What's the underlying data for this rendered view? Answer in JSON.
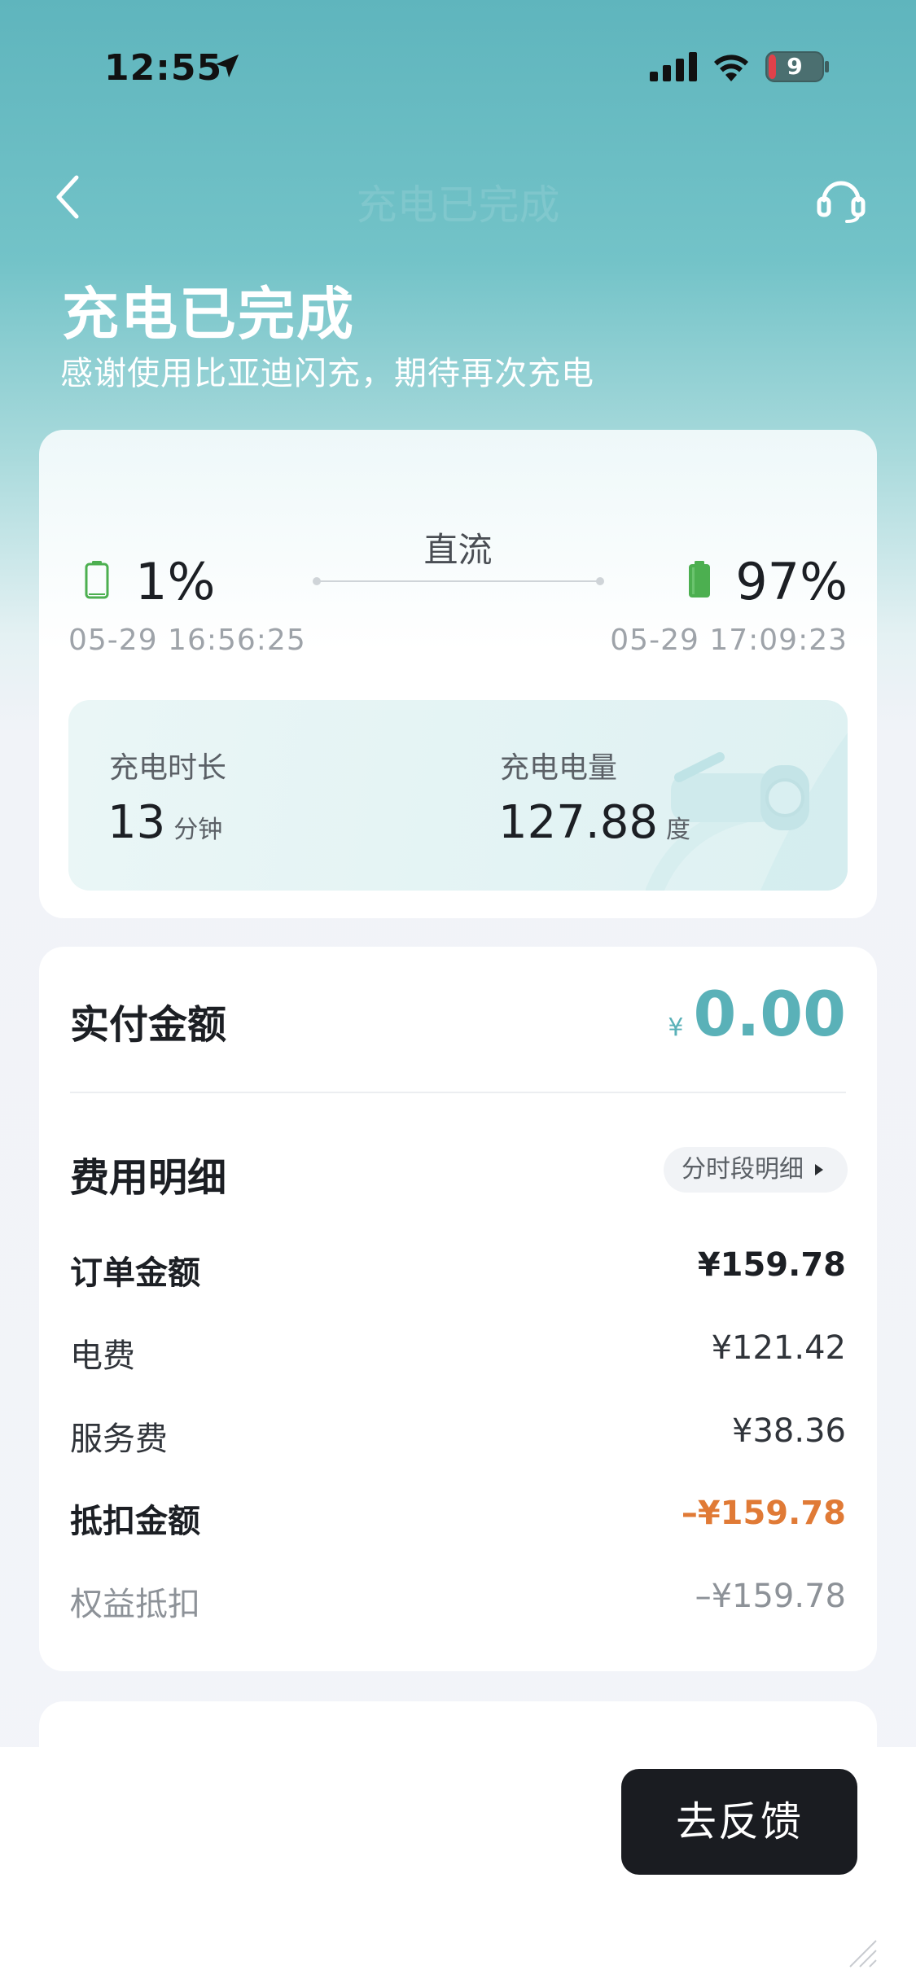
{
  "status_bar": {
    "time": "12:55",
    "battery_level": "9"
  },
  "nav": {
    "title": "充电已完成"
  },
  "header": {
    "title": "充电已完成",
    "subtitle": "感谢使用比亚迪闪充，期待再次充电"
  },
  "session": {
    "type": "直流",
    "start_percent": "1%",
    "start_time": "05-29 16:56:25",
    "end_percent": "97%",
    "end_time": "05-29 17:09:23",
    "duration_label": "充电时长",
    "duration_value": "13",
    "duration_unit": "分钟",
    "energy_label": "充电电量",
    "energy_value": "127.88",
    "energy_unit": "度"
  },
  "payment": {
    "paid_label": "实付金额",
    "currency": "¥",
    "paid_amount": "0.00",
    "details_title": "费用明细",
    "details_button": "分时段明细",
    "rows": [
      {
        "label": "订单金额",
        "value": "¥159.78"
      },
      {
        "label": "电费",
        "value": "¥121.42"
      },
      {
        "label": "服务费",
        "value": "¥38.36"
      },
      {
        "label": "抵扣金额",
        "value": "–¥159.78"
      },
      {
        "label": "权益抵扣",
        "value": "–¥159.78"
      }
    ]
  },
  "footer": {
    "feedback_button": "去反馈"
  },
  "colors": {
    "accent": "#5ab1b8",
    "discount": "#e07a36",
    "battery_green": "#4caf50",
    "button_dark": "#1a1c21"
  }
}
